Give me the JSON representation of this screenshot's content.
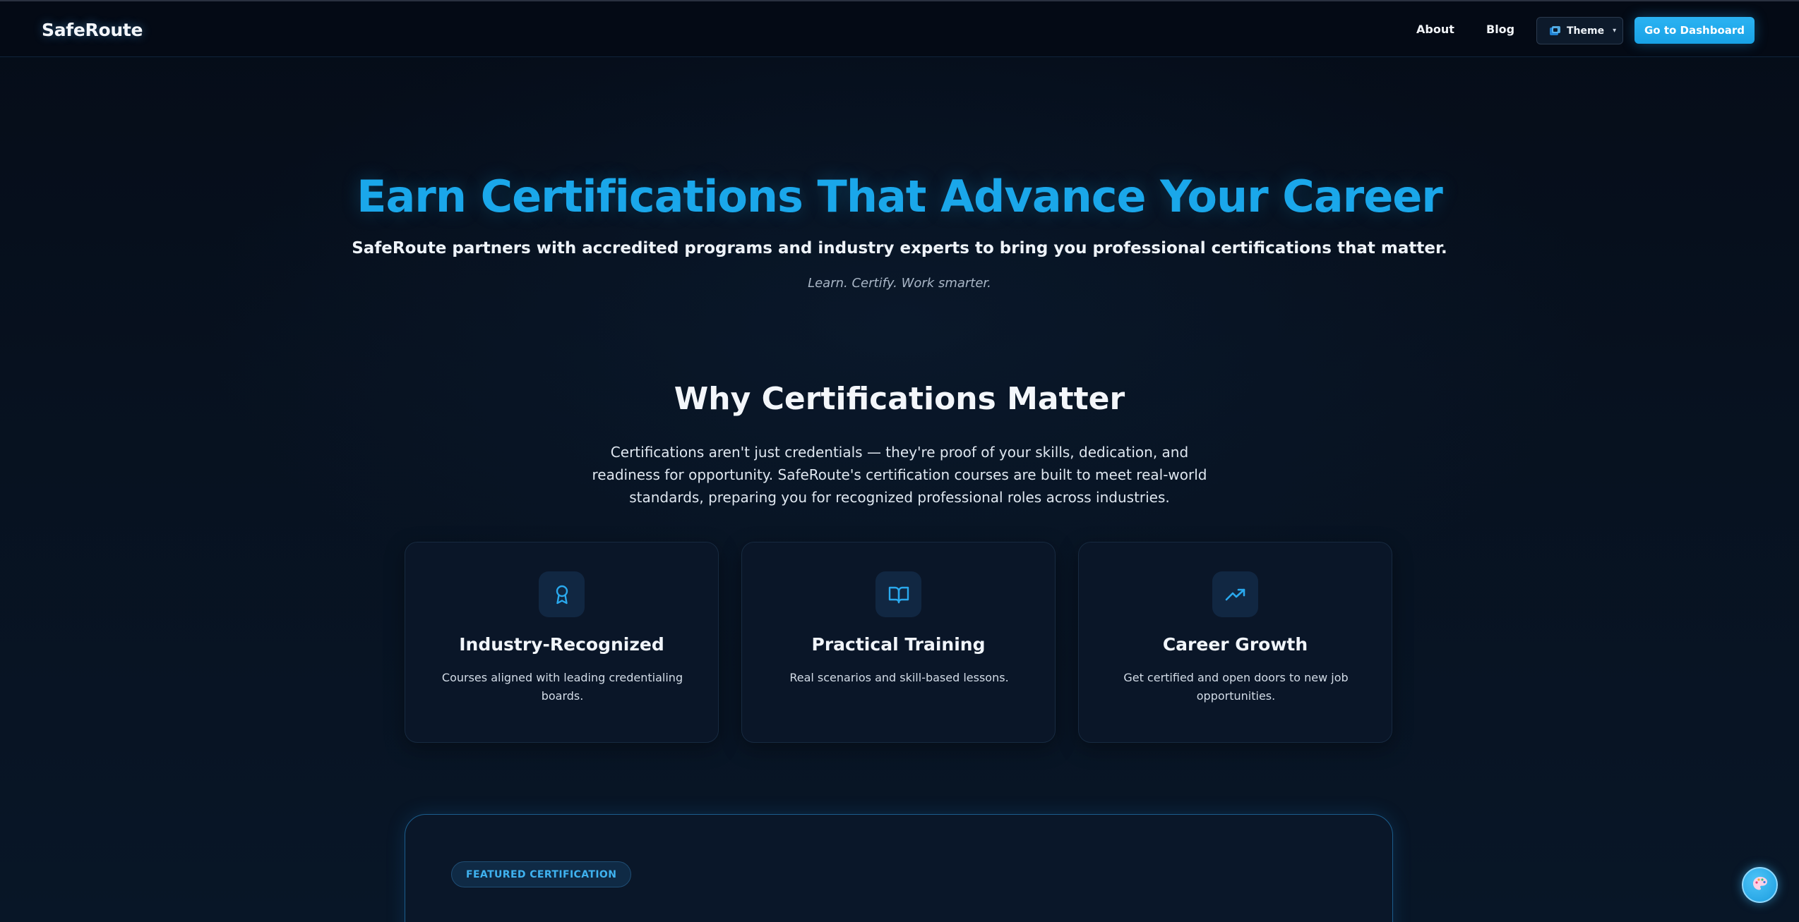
{
  "header": {
    "brand": "SafeRoute",
    "nav": {
      "about": "About",
      "blog": "Blog"
    },
    "theme": {
      "label": "Theme",
      "caret": "▾",
      "icon": "color-swatch-icon"
    },
    "dashboard_button": "Go to Dashboard"
  },
  "hero": {
    "title": "Earn Certifications That Advance Your Career",
    "subtitle": "SafeRoute partners with accredited programs and industry experts to bring you professional certifications that matter.",
    "tagline": "Learn. Certify. Work smarter."
  },
  "why": {
    "title": "Why Certifications Matter",
    "body": "Certifications aren't just credentials — they're proof of your skills, dedication, and readiness for opportunity. SafeRoute's certification courses are built to meet real-world standards, preparing you for recognized professional roles across industries."
  },
  "cards": [
    {
      "icon": "award-icon",
      "title": "Industry-Recognized",
      "description": "Courses aligned with leading credentialing boards."
    },
    {
      "icon": "open-book-icon",
      "title": "Practical Training",
      "description": "Real scenarios and skill-based lessons."
    },
    {
      "icon": "trending-up-icon",
      "title": "Career Growth",
      "description": "Get certified and open doors to new job opportunities."
    }
  ],
  "featured": {
    "badge": "FEATURED CERTIFICATION"
  },
  "floating": {
    "icon": "palette-icon"
  },
  "colors": {
    "accent": "#1aa7ea",
    "background": "#06101e",
    "card": "#0a1628",
    "button": "#1fa9ec"
  }
}
